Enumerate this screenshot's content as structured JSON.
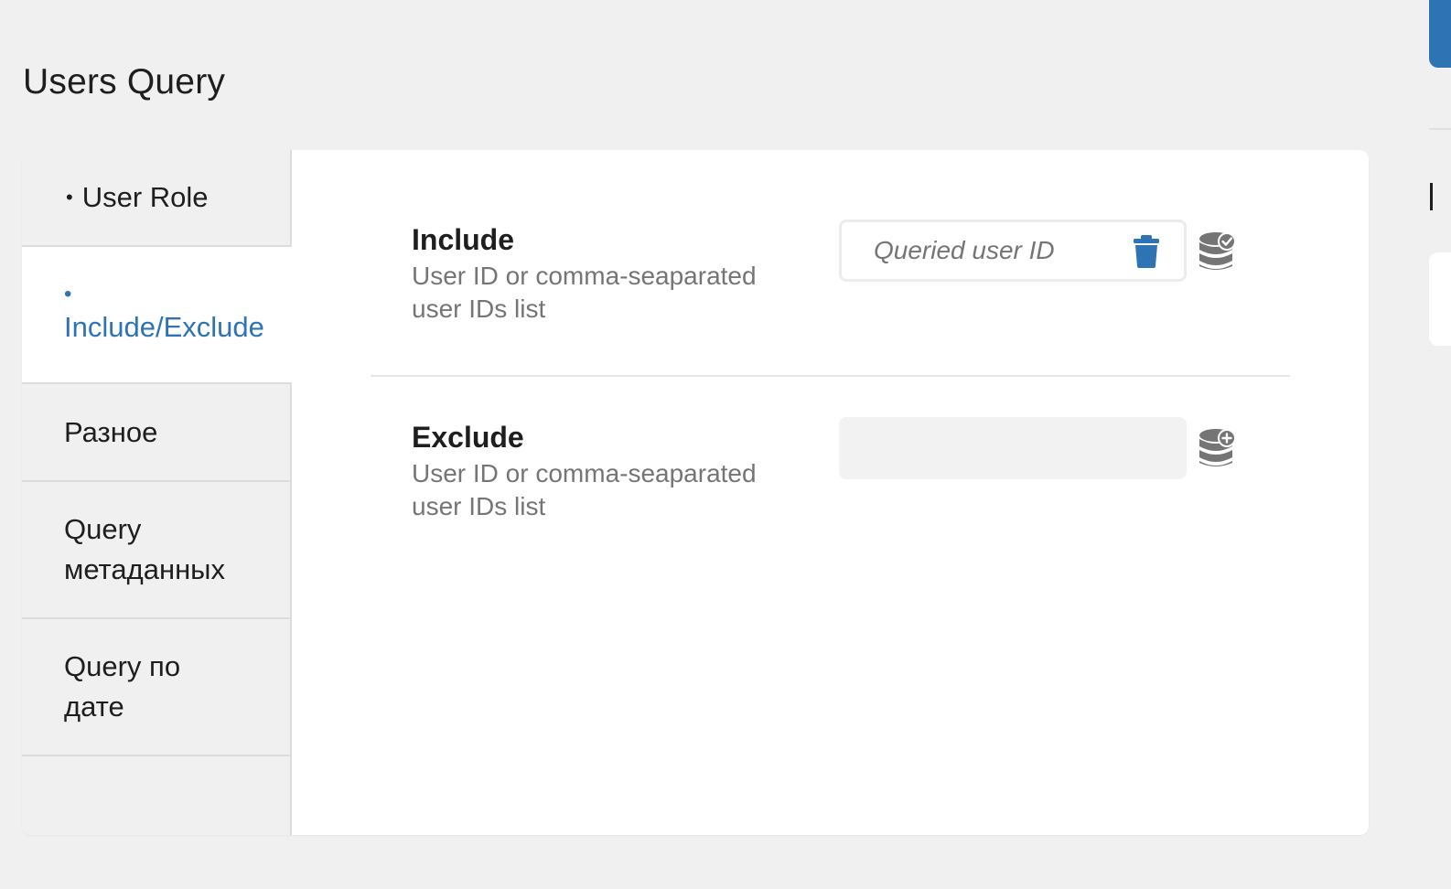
{
  "page": {
    "title": "Users Query"
  },
  "tabs": [
    {
      "label": "User Role",
      "active": false,
      "has_bullet": true
    },
    {
      "label": "Include/Exclude",
      "active": true,
      "has_bullet": true
    },
    {
      "label": "Разное",
      "active": false,
      "has_bullet": false
    },
    {
      "label": "Query метаданных",
      "active": false,
      "has_bullet": false
    },
    {
      "label": "Query по дате",
      "active": false,
      "has_bullet": false
    }
  ],
  "bullet_char": "•",
  "fields": {
    "include": {
      "label": "Include",
      "description": "User ID or comma-seaparated user IDs list",
      "placeholder": "Queried user ID",
      "value": "",
      "clear_icon": "trash-icon",
      "dynamic_icon": "database-check-icon"
    },
    "exclude": {
      "label": "Exclude",
      "description": "User ID or comma-seaparated user IDs list",
      "placeholder": "",
      "value": "",
      "dynamic_icon": "database-plus-icon"
    }
  },
  "colors": {
    "accent": "#2e73b4",
    "background": "#f0f0f1",
    "panel": "#ffffff",
    "muted_text": "#757575",
    "icon_gray": "#757575"
  }
}
